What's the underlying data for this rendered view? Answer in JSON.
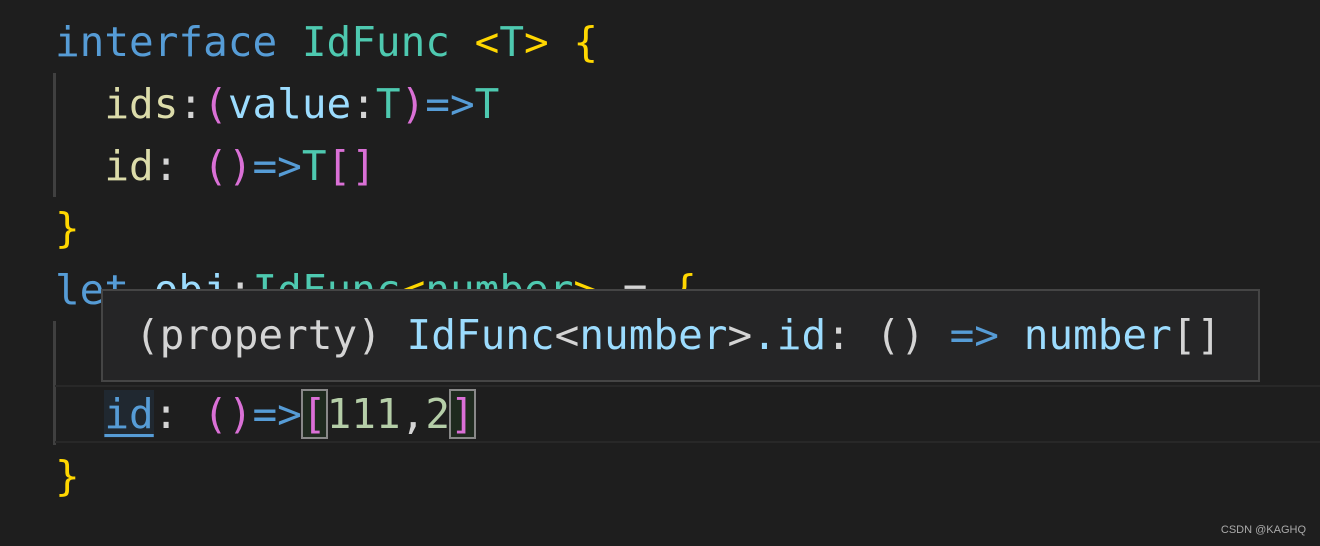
{
  "editor": {
    "lines": [
      {
        "indent": 0,
        "tokens": [
          [
            "interface",
            "kw"
          ],
          [
            " ",
            "pu"
          ],
          [
            "IdFunc",
            "ty"
          ],
          [
            " ",
            "pu"
          ],
          [
            "<",
            "yb"
          ],
          [
            "T",
            "ty"
          ],
          [
            ">",
            "yb"
          ],
          [
            " ",
            "pu"
          ],
          [
            "{",
            "yb"
          ]
        ]
      },
      {
        "indent": 2,
        "tokens": [
          [
            "ids",
            "pr"
          ],
          [
            ":",
            "pu"
          ],
          [
            "(",
            "pb"
          ],
          [
            "value",
            "va"
          ],
          [
            ":",
            "pu"
          ],
          [
            "T",
            "ty"
          ],
          [
            ")",
            "pb"
          ],
          [
            "=>",
            "ar"
          ],
          [
            "T",
            "ty"
          ]
        ]
      },
      {
        "indent": 2,
        "tokens": [
          [
            "id",
            "pr"
          ],
          [
            ": ",
            "pu"
          ],
          [
            "(",
            "pb"
          ],
          [
            ")",
            "pb"
          ],
          [
            "=>",
            "ar"
          ],
          [
            "T",
            "ty"
          ],
          [
            "[",
            "pb"
          ],
          [
            "]",
            "pb"
          ]
        ]
      },
      {
        "indent": 0,
        "tokens": [
          [
            "}",
            "yb"
          ]
        ]
      },
      {
        "indent": 0,
        "tokens": [
          [
            "let",
            "kw"
          ],
          [
            " ",
            "pu"
          ],
          [
            "obj",
            "va"
          ],
          [
            ":",
            "pu"
          ],
          [
            "IdFunc",
            "ty"
          ],
          [
            "<",
            "yb"
          ],
          [
            "number",
            "ty"
          ],
          [
            ">",
            "yb"
          ],
          [
            " = ",
            "pu"
          ],
          [
            "{",
            "yb"
          ]
        ]
      },
      {
        "indent": 2,
        "tokens": []
      },
      {
        "indent": 2,
        "tokens": [
          [
            "id",
            "hl"
          ],
          [
            ": ",
            "pu"
          ],
          [
            "(",
            "pb"
          ],
          [
            ")",
            "pb"
          ],
          [
            "=>",
            "ar"
          ],
          [
            "[",
            "pb bm"
          ],
          [
            "111",
            "nu"
          ],
          [
            ",",
            "pu"
          ],
          [
            "2",
            "nu"
          ],
          [
            "]",
            "pb bm"
          ]
        ]
      },
      {
        "indent": 0,
        "tokens": [
          [
            "}",
            "yb"
          ]
        ]
      }
    ]
  },
  "hover": {
    "tokens": [
      [
        "(property)",
        "pu"
      ],
      [
        " IdFunc",
        "va"
      ],
      [
        "<",
        "pu"
      ],
      [
        "number",
        "va"
      ],
      [
        ">",
        "pu"
      ],
      [
        ".id",
        ""
      ],
      [
        ": ",
        "pu"
      ],
      [
        "()",
        "pu"
      ],
      [
        " => ",
        "ar"
      ],
      [
        "number",
        "va"
      ],
      [
        "[]",
        "pu"
      ]
    ]
  },
  "watermark": "CSDN @KAGHQ",
  "colors": {
    "background": "#1e1e1e",
    "keyword": "#569cd6",
    "type": "#4ec9b0",
    "bracket": "#ffd700",
    "bracket2": "#da70d6"
  }
}
